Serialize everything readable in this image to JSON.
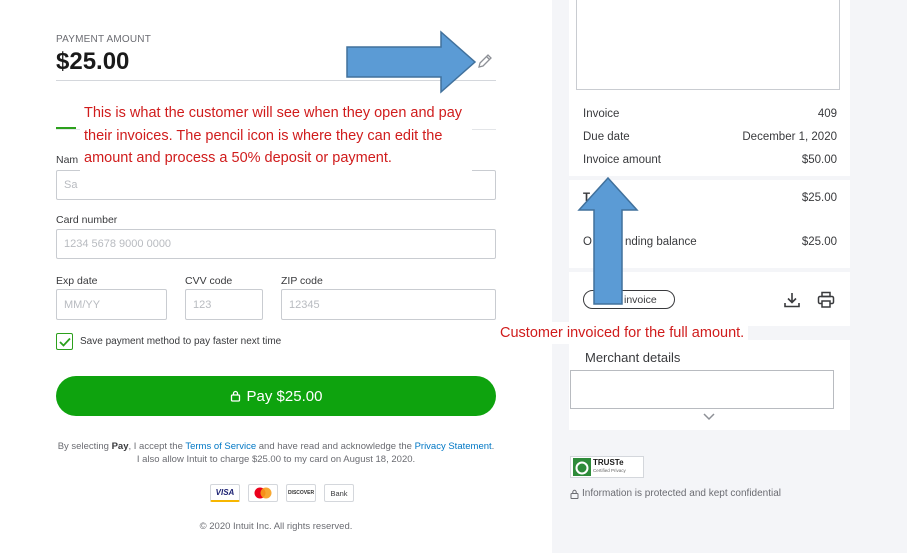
{
  "payment": {
    "amount_label": "PAYMENT AMOUNT",
    "amount": "$25.00",
    "name_label": "Nam",
    "name_placeholder": "Sa",
    "card_number_label": "Card number",
    "card_number_placeholder": "1234 5678 9000 0000",
    "exp_label": "Exp date",
    "exp_placeholder": "MM/YY",
    "cvv_label": "CVV code",
    "cvv_placeholder": "123",
    "zip_label": "ZIP code",
    "zip_placeholder": "12345",
    "save_method_label": "Save payment method to pay faster next time",
    "save_method_checked": true,
    "pay_button_label": "Pay $25.00",
    "legal": {
      "part1": "By selecting ",
      "pay_word": "Pay",
      "part2": ", I accept the ",
      "terms_link": "Terms of Service",
      "part3": " and have read and acknowledge the ",
      "privacy_link": "Privacy Statement",
      "part4": ". I also allow Intuit to charge $25.00 to my card on August 18, 2020."
    },
    "card_brands": [
      "VISA",
      "MC",
      "DISCOVER",
      "Bank"
    ],
    "copyright": "© 2020 Intuit Inc. All rights reserved."
  },
  "annotation_top": "This is what the customer will see when they open and pay their invoices. The pencil icon is where they can edit the amount and process a 50% deposit or payment.",
  "annotation_bottom": "Customer invoiced for the full amount.",
  "summary": {
    "invoice_label": "Invoice",
    "invoice_value": "409",
    "due_label": "Due date",
    "due_value": "December 1, 2020",
    "amount_label": "Invoice amount",
    "amount_value": "$50.00",
    "total_label_partial": "T",
    "total_value": "$25.00",
    "outstanding_label_partial_a": "O",
    "outstanding_label_partial_b": "nding balance",
    "outstanding_value": "$25.00",
    "invoice_pill_label": "invoice"
  },
  "merchant": {
    "title": "Merchant details"
  },
  "trust": {
    "badge": "TRUSTe",
    "badge_sub": "Certified Privacy",
    "protected_text": "Information is protected and kept confidential"
  },
  "colors": {
    "accent_green": "#0ea30e",
    "annotation_red": "#d01c1c",
    "arrow_blue": "#5b9bd5",
    "link_blue": "#0077c5"
  }
}
